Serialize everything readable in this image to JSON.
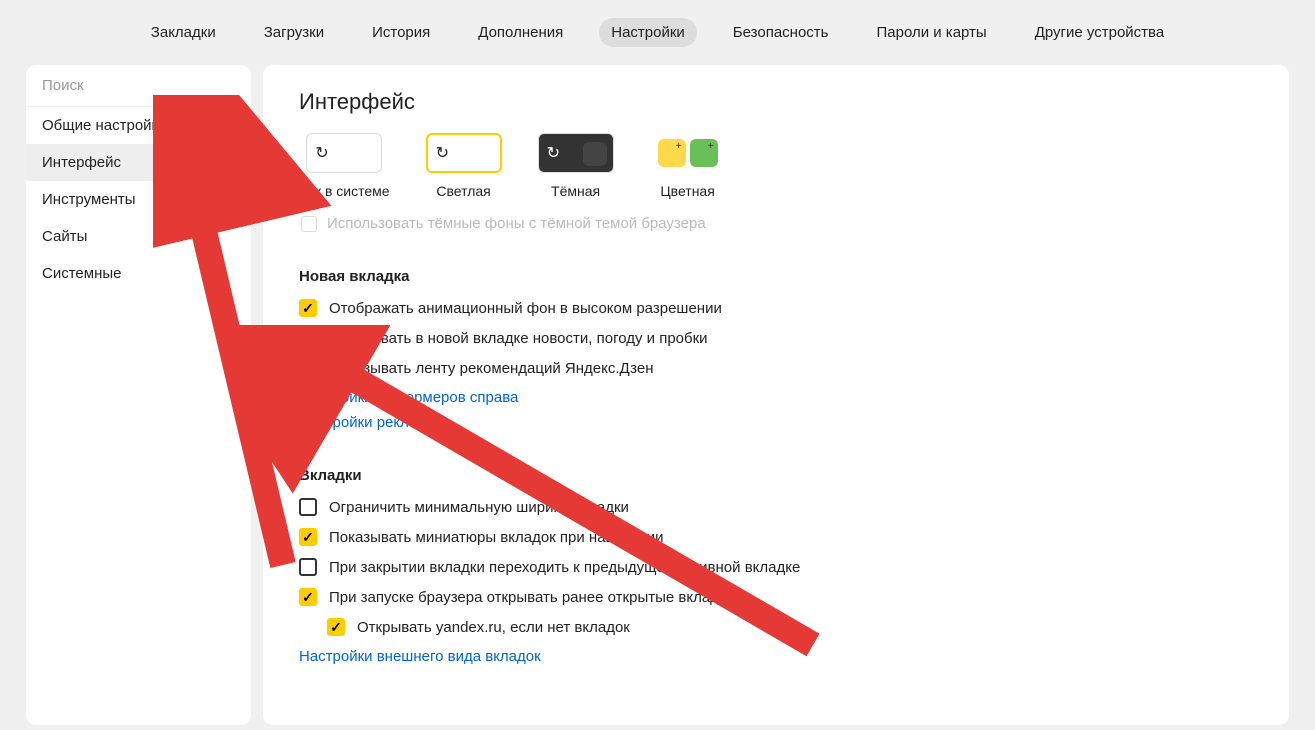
{
  "topnav": {
    "items": [
      {
        "label": "Закладки"
      },
      {
        "label": "Загрузки"
      },
      {
        "label": "История"
      },
      {
        "label": "Дополнения"
      },
      {
        "label": "Настройки",
        "active": true
      },
      {
        "label": "Безопасность"
      },
      {
        "label": "Пароли и карты"
      },
      {
        "label": "Другие устройства"
      }
    ]
  },
  "sidebar": {
    "search_placeholder": "Поиск",
    "items": [
      {
        "label": "Общие настройки"
      },
      {
        "label": "Интерфейс",
        "active": true
      },
      {
        "label": "Инструменты"
      },
      {
        "label": "Сайты"
      },
      {
        "label": "Системные"
      }
    ]
  },
  "main": {
    "title": "Интерфейс",
    "themes": {
      "system": "Как в системе",
      "light": "Светлая",
      "dark": "Тёмная",
      "color": "Цветная"
    },
    "dark_bg_option": "Использовать тёмные фоны с тёмной темой браузера",
    "new_tab_section": {
      "title": "Новая вкладка",
      "opts": [
        {
          "label": "Отображать анимационный фон в высоком разрешении",
          "checked": true
        },
        {
          "label": "Показывать в новой вкладке новости, погоду и пробки",
          "checked": true
        },
        {
          "label": "Показывать ленту рекомендаций Яндекс.Дзен",
          "checked": false
        }
      ],
      "links": [
        "Настройки информеров справа",
        "Настройки рекламы"
      ]
    },
    "tabs_section": {
      "title": "Вкладки",
      "opts": [
        {
          "label": "Ограничить минимальную ширину вкладки",
          "checked": false
        },
        {
          "label": "Показывать миниатюры вкладок при наведении",
          "checked": true
        },
        {
          "label": "При закрытии вкладки переходить к предыдущей активной вкладке",
          "checked": false
        },
        {
          "label": "При запуске браузера открывать ранее открытые вкладки",
          "checked": true
        },
        {
          "label": "Открывать yandex.ru, если нет вкладок",
          "checked": true,
          "nested": true
        }
      ],
      "link": "Настройки внешнего вида вкладок"
    }
  }
}
